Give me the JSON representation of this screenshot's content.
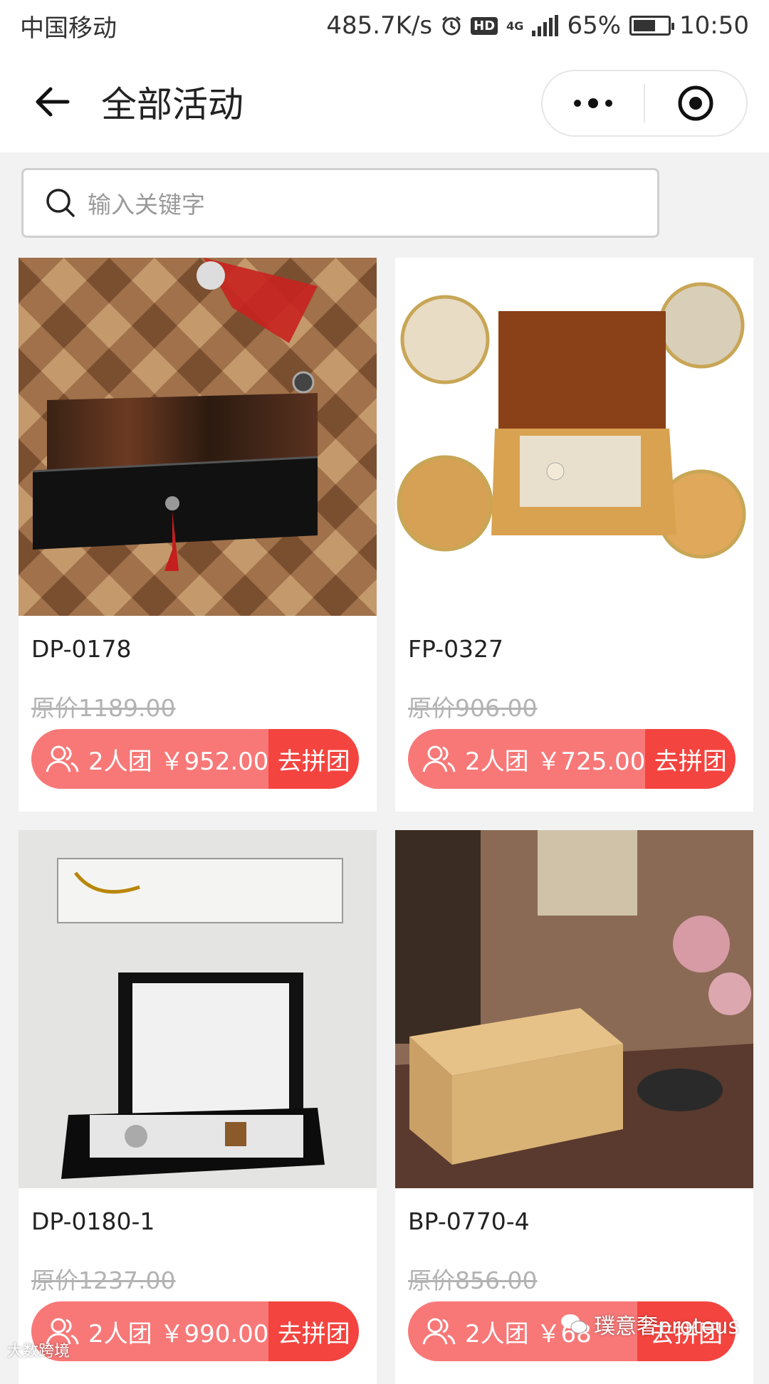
{
  "status_bar": {
    "carrier": "中国移动",
    "speed": "485.7K/s",
    "hd": "HD",
    "network": "4G",
    "battery": "65%",
    "battery_level": 0.65,
    "time": "10:50"
  },
  "nav": {
    "title": "全部活动",
    "back_icon": "arrow-left-icon",
    "menu_icon": "more-dots-icon",
    "close_icon": "target-circle-icon"
  },
  "search": {
    "placeholder": "输入关键字"
  },
  "products": [
    {
      "code": "DP-0178",
      "original": "原价1189.00",
      "group": "2人团 ￥952.00",
      "action": "去拼团"
    },
    {
      "code": "FP-0327",
      "original": "原价906.00",
      "group": "2人团 ￥725.00",
      "action": "去拼团"
    },
    {
      "code": "DP-0180-1",
      "original": "原价1237.00",
      "group": "2人团 ￥990.00",
      "action": "去拼团"
    },
    {
      "code": "BP-0770-4",
      "original": "原价856.00",
      "group": "2人团 ￥68",
      "action": "去拼团"
    }
  ],
  "watermark": {
    "text": "璞意奢proteus",
    "corner": "大数跨境"
  },
  "colors": {
    "btn_left": "#f87878",
    "btn_right": "#f4443f"
  }
}
